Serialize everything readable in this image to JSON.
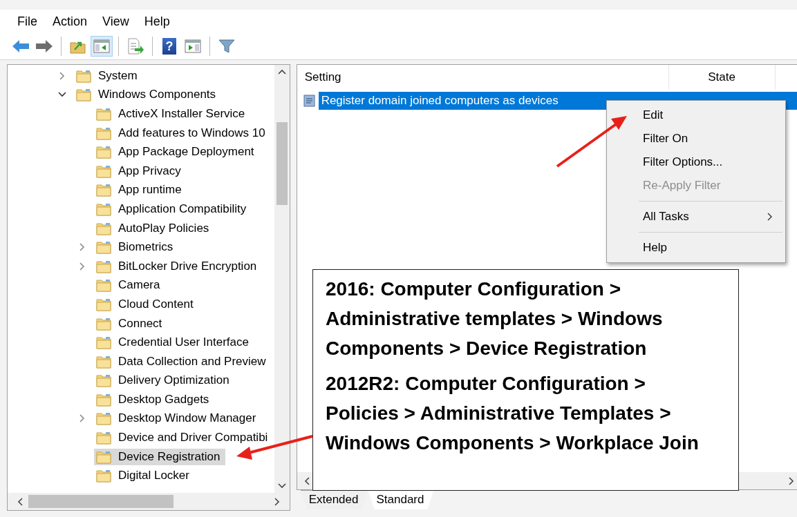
{
  "menu_bar": [
    "File",
    "Action",
    "View",
    "Help"
  ],
  "toolbar": {
    "buttons": [
      {
        "pressed": false
      },
      {
        "pressed": false
      },
      {
        "pressed": false
      },
      {
        "pressed": true
      },
      {
        "pressed": false
      },
      {
        "pressed": false,
        "glyph": "?"
      },
      {
        "pressed": false
      },
      {
        "pressed": false
      }
    ]
  },
  "tree": {
    "items": [
      {
        "label": "System",
        "expandable": true,
        "expanded": false,
        "selected": false
      },
      {
        "label": "Windows Components",
        "expandable": true,
        "expanded": true,
        "selected": false,
        "children": [
          {
            "label": "ActiveX Installer Service",
            "expandable": false,
            "selected": false
          },
          {
            "label": "Add features to Windows 10",
            "expandable": false,
            "selected": false
          },
          {
            "label": "App Package Deployment",
            "expandable": false,
            "selected": false
          },
          {
            "label": "App Privacy",
            "expandable": false,
            "selected": false
          },
          {
            "label": "App runtime",
            "expandable": false,
            "selected": false
          },
          {
            "label": "Application Compatibility",
            "expandable": false,
            "selected": false
          },
          {
            "label": "AutoPlay Policies",
            "expandable": false,
            "selected": false
          },
          {
            "label": "Biometrics",
            "expandable": true,
            "expanded": false,
            "selected": false
          },
          {
            "label": "BitLocker Drive Encryption",
            "expandable": true,
            "expanded": false,
            "selected": false
          },
          {
            "label": "Camera",
            "expandable": false,
            "selected": false
          },
          {
            "label": "Cloud Content",
            "expandable": false,
            "selected": false
          },
          {
            "label": "Connect",
            "expandable": false,
            "selected": false
          },
          {
            "label": "Credential User Interface",
            "expandable": false,
            "selected": false
          },
          {
            "label": "Data Collection and Preview",
            "expandable": false,
            "selected": false
          },
          {
            "label": "Delivery Optimization",
            "expandable": false,
            "selected": false
          },
          {
            "label": "Desktop Gadgets",
            "expandable": false,
            "selected": false
          },
          {
            "label": "Desktop Window Manager",
            "expandable": true,
            "expanded": false,
            "selected": false
          },
          {
            "label": "Device and Driver Compatibi",
            "expandable": false,
            "selected": false
          },
          {
            "label": "Device Registration",
            "expandable": false,
            "selected": true
          },
          {
            "label": "Digital Locker",
            "expandable": false,
            "selected": false
          }
        ]
      }
    ]
  },
  "settings_list": {
    "columns": [
      "Setting",
      "State"
    ],
    "rows": [
      {
        "setting": "Register domain joined computers as devices",
        "selected": true
      }
    ]
  },
  "context_menu": {
    "items": [
      {
        "kind": "item",
        "label": "Edit",
        "disabled": false,
        "submenu": false
      },
      {
        "kind": "item",
        "label": "Filter On",
        "disabled": false,
        "submenu": false
      },
      {
        "kind": "item",
        "label": "Filter Options...",
        "disabled": false,
        "submenu": false
      },
      {
        "kind": "item",
        "label": "Re-Apply Filter",
        "disabled": true,
        "submenu": false
      },
      {
        "kind": "separator"
      },
      {
        "kind": "item",
        "label": "All Tasks",
        "disabled": false,
        "submenu": true
      },
      {
        "kind": "separator"
      },
      {
        "kind": "item",
        "label": "Help",
        "disabled": false,
        "submenu": false
      }
    ]
  },
  "callout": {
    "paragraphs": [
      "2016: Computer Configuration > Administrative templates > Windows Components > Device Registration",
      "2012R2: Computer Configuration > Policies > Administrative Templates > Windows Components > Workplace Join"
    ]
  },
  "tabs": [
    {
      "label": "Extended",
      "selected": false
    },
    {
      "label": "Standard",
      "selected": true
    }
  ]
}
